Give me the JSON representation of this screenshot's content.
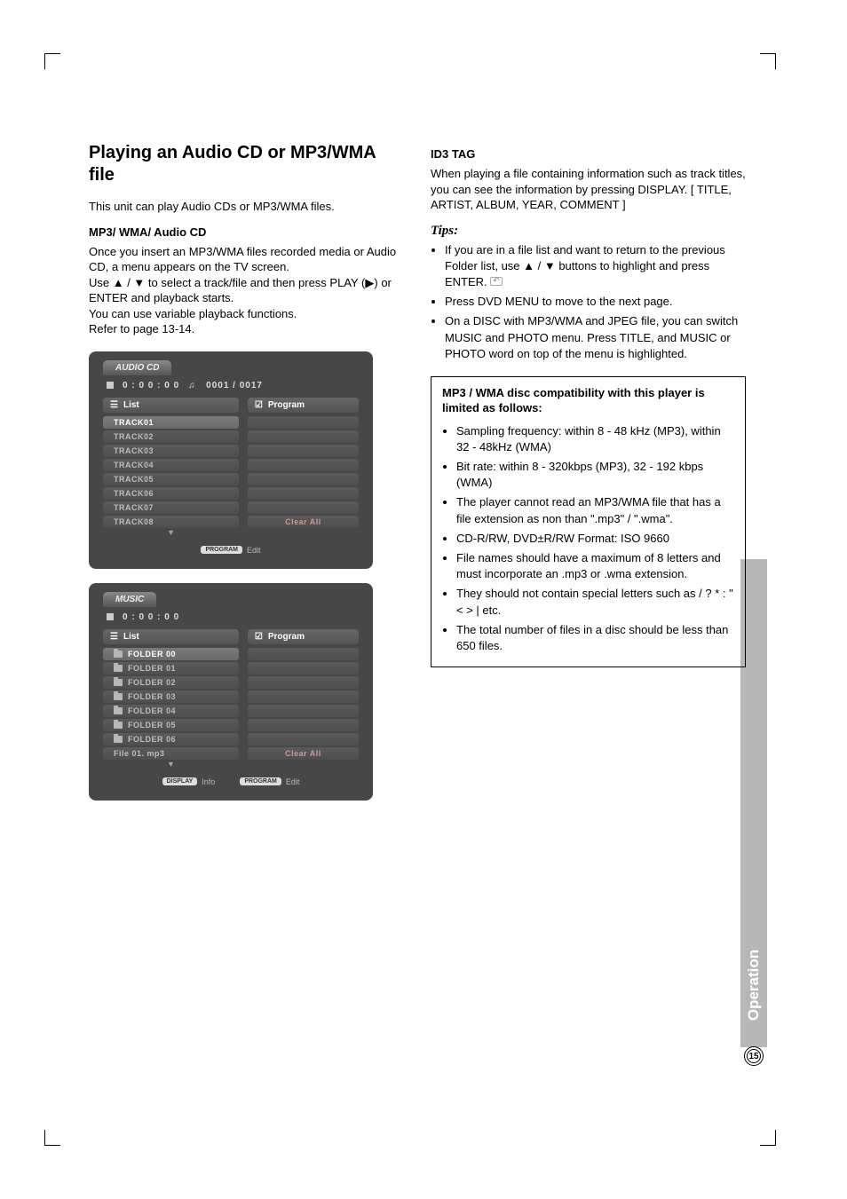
{
  "sideTab": "Operation",
  "pageNumber": "15",
  "left": {
    "h1": "Playing an Audio CD or MP3/WMA file",
    "intro": "This unit can play Audio CDs or MP3/WMA files.",
    "sub1": "MP3/ WMA/ Audio CD",
    "p1a": "Once you insert an MP3/WMA files recorded media or Audio CD, a menu appears on the TV screen.",
    "p1b": "Use ▲ / ▼ to select a track/file and then press PLAY (▶) or ENTER and playback starts.",
    "p1c": "You can use variable playback functions.",
    "p1d": "Refer to page 13-14."
  },
  "osd1": {
    "tab": "AUDIO CD",
    "time": "0 : 0 0 : 0 0",
    "counter": "0001 / 0017",
    "listLabel": "List",
    "progLabel": "Program",
    "tracks": [
      "TRACK01",
      "TRACK02",
      "TRACK03",
      "TRACK04",
      "TRACK05",
      "TRACK06",
      "TRACK07",
      "TRACK08"
    ],
    "clearAll": "Clear  All",
    "footerEdit": "Edit",
    "footerBadgeProgram": "PROGRAM"
  },
  "osd2": {
    "tab": "MUSIC",
    "time": "0 : 0 0 : 0 0",
    "listLabel": "List",
    "progLabel": "Program",
    "items": [
      {
        "icon": "folder",
        "label": "FOLDER  00"
      },
      {
        "icon": "folder",
        "label": "FOLDER  01"
      },
      {
        "icon": "folder",
        "label": "FOLDER  02"
      },
      {
        "icon": "folder",
        "label": "FOLDER  03"
      },
      {
        "icon": "folder",
        "label": "FOLDER  04"
      },
      {
        "icon": "folder",
        "label": "FOLDER  05"
      },
      {
        "icon": "folder",
        "label": "FOLDER  06"
      },
      {
        "icon": "file",
        "label": "File 01. mp3"
      }
    ],
    "clearAll": "Clear  All",
    "footerBadgeDisplay": "DISPLAY",
    "footerInfo": "Info",
    "footerBadgeProgram": "PROGRAM",
    "footerEdit": "Edit"
  },
  "right": {
    "id3Head": "ID3 TAG",
    "id3Body": "When playing a file containing information such as track titles, you can see the information by pressing DISPLAY. [ TITLE, ARTIST, ALBUM, YEAR, COMMENT ]",
    "tipsHead": "Tips:",
    "tips": [
      "If you are in a file list and want to return to the previous Folder list, use ▲ / ▼ buttons to highlight      and press ENTER.",
      "Press DVD MENU to move to the next page.",
      "On a DISC with MP3/WMA and JPEG file, you can switch MUSIC and PHOTO menu. Press TITLE, and MUSIC or PHOTO word on top of the menu is highlighted."
    ],
    "compatHead": "MP3 / WMA disc compatibility with this player is limited as follows:",
    "compat": [
      "Sampling frequency: within 8 - 48 kHz (MP3), within 32 - 48kHz (WMA)",
      "Bit rate: within 8 - 320kbps (MP3), 32 - 192 kbps (WMA)",
      "The player cannot read an MP3/WMA file that has a file extension as non than \".mp3\" / \".wma\".",
      "CD-R/RW, DVD±R/RW Format: ISO 9660",
      "File names should have a maximum of 8 letters and must incorporate an .mp3 or .wma extension.",
      "They should not contain special letters such as / ? * : \" < > | etc.",
      "The total number of files in a disc should be less than 650 files."
    ]
  }
}
